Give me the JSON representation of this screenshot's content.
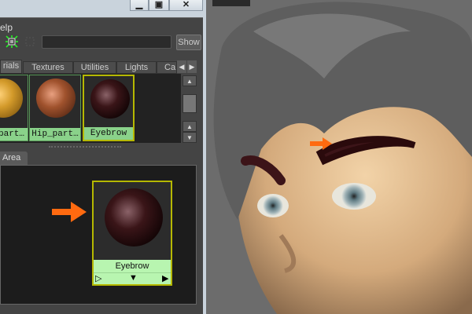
{
  "window": {
    "minimize": "▁",
    "maximize": "▣",
    "close": "✕"
  },
  "menu": {
    "help": "elp"
  },
  "toolbar": {
    "show_label": "Show",
    "filter_value": ""
  },
  "tabs": [
    {
      "label": "rials",
      "active": true
    },
    {
      "label": "Textures"
    },
    {
      "label": "Utilities"
    },
    {
      "label": "Lights"
    },
    {
      "label": "Ca"
    }
  ],
  "swatches": [
    {
      "label": "_part…",
      "color": "#d39a2a"
    },
    {
      "label": "Hip_part…",
      "color": "#a0522d"
    },
    {
      "label": "Eyebrow",
      "color": "#2a0a0c",
      "selected": true
    }
  ],
  "work_area": {
    "tab_label": "Area",
    "node": {
      "label": "Eyebrow"
    }
  },
  "annotation_color": "#ff6a10"
}
